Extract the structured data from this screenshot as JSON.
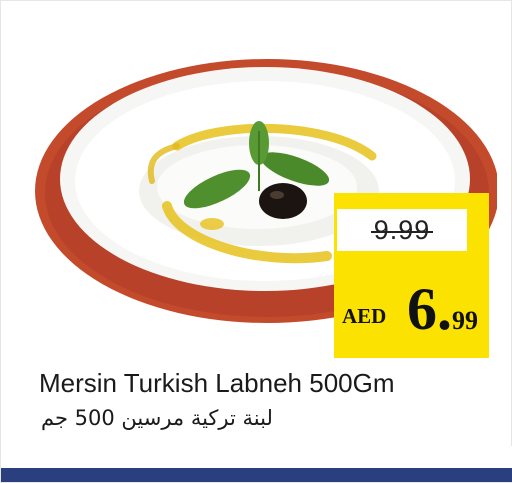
{
  "product": {
    "name_en": "Mersin Turkish Labneh 500Gm",
    "name_ar": "لبنة تركية مرسين 500 جم",
    "image_icon": "labneh-plate-image"
  },
  "price": {
    "old": "9.99",
    "currency": "AED",
    "new_whole": "6.",
    "new_fraction": "99"
  },
  "colors": {
    "price_box": "#fbe200",
    "plate_rim": "#c44a2c",
    "footer_bar": "#2a3f7e"
  }
}
